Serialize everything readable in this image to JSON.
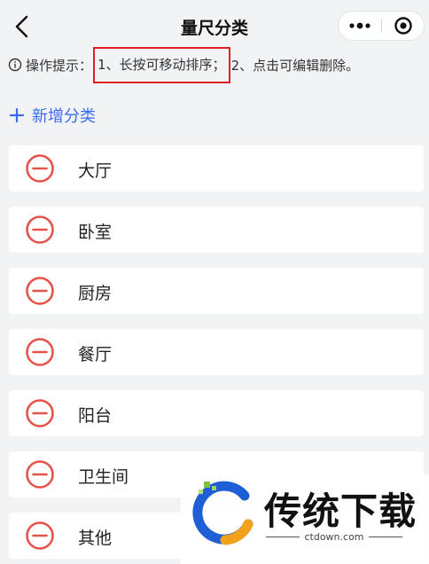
{
  "nav": {
    "title": "量尺分类"
  },
  "tip": {
    "prefix": "操作提示：",
    "highlight": "1、长按可移动排序；",
    "suffix": "2、点击可编辑删除。"
  },
  "add": {
    "label": "新增分类"
  },
  "categories": [
    {
      "label": "大厅"
    },
    {
      "label": "卧室"
    },
    {
      "label": "厨房"
    },
    {
      "label": "餐厅"
    },
    {
      "label": "阳台"
    },
    {
      "label": "卫生间"
    },
    {
      "label": "其他"
    }
  ],
  "colors": {
    "accent": "#3a6cf2",
    "remove": "#e5534b",
    "highlight_border": "#e21d24",
    "background": "#f2f3f5"
  },
  "icons": {
    "back": "chevron-left-icon",
    "more": "more-dots-icon",
    "close": "target-close-icon",
    "info": "info-circle-icon",
    "add": "plus-icon",
    "remove": "minus-circle-icon"
  },
  "watermark": {
    "name": "传统下载",
    "url": "ctdown.com"
  }
}
